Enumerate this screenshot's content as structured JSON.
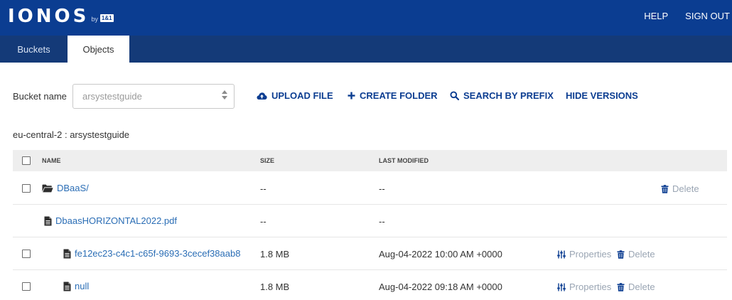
{
  "header": {
    "logo_text": "IONOS",
    "logo_by": "by",
    "logo_brand": "1&1",
    "help": "HELP",
    "signout": "SIGN OUT"
  },
  "tabs": [
    {
      "label": "Buckets",
      "active": false
    },
    {
      "label": "Objects",
      "active": true
    }
  ],
  "toolbar": {
    "bucket_label": "Bucket name",
    "bucket_value": "arsystestguide",
    "upload": "UPLOAD FILE",
    "create_folder": "CREATE FOLDER",
    "search_prefix": "SEARCH BY PREFIX",
    "hide_versions": "HIDE VERSIONS"
  },
  "path": "eu-central-2 : arsystestguide",
  "table": {
    "columns": [
      "NAME",
      "SIZE",
      "LAST MODIFIED"
    ],
    "rows": [
      {
        "type": "folder",
        "name": "DBaaS/",
        "size": "--",
        "modified": "--",
        "delete": "Delete",
        "checkbox": true
      },
      {
        "type": "file",
        "name": "DbaasHORIZONTAL2022.pdf",
        "size": "--",
        "modified": "--",
        "checkbox": false
      },
      {
        "type": "version",
        "name": "fe12ec23-c4c1-c65f-9693-3cecef38aab8",
        "size": "1.8 MB",
        "modified": "Aug-04-2022 10:00 AM +0000",
        "properties": "Properties",
        "delete": "Delete",
        "checkbox": true
      },
      {
        "type": "version",
        "name": "null",
        "size": "1.8 MB",
        "modified": "Aug-04-2022 09:18 AM +0000",
        "properties": "Properties",
        "delete": "Delete",
        "checkbox": true
      }
    ]
  },
  "colors": {
    "header_bg": "#0b3d91",
    "tabbar_bg": "#143a78",
    "link": "#2a6db5",
    "action_text": "#0b3d91",
    "muted_action": "#9aa5b3"
  }
}
